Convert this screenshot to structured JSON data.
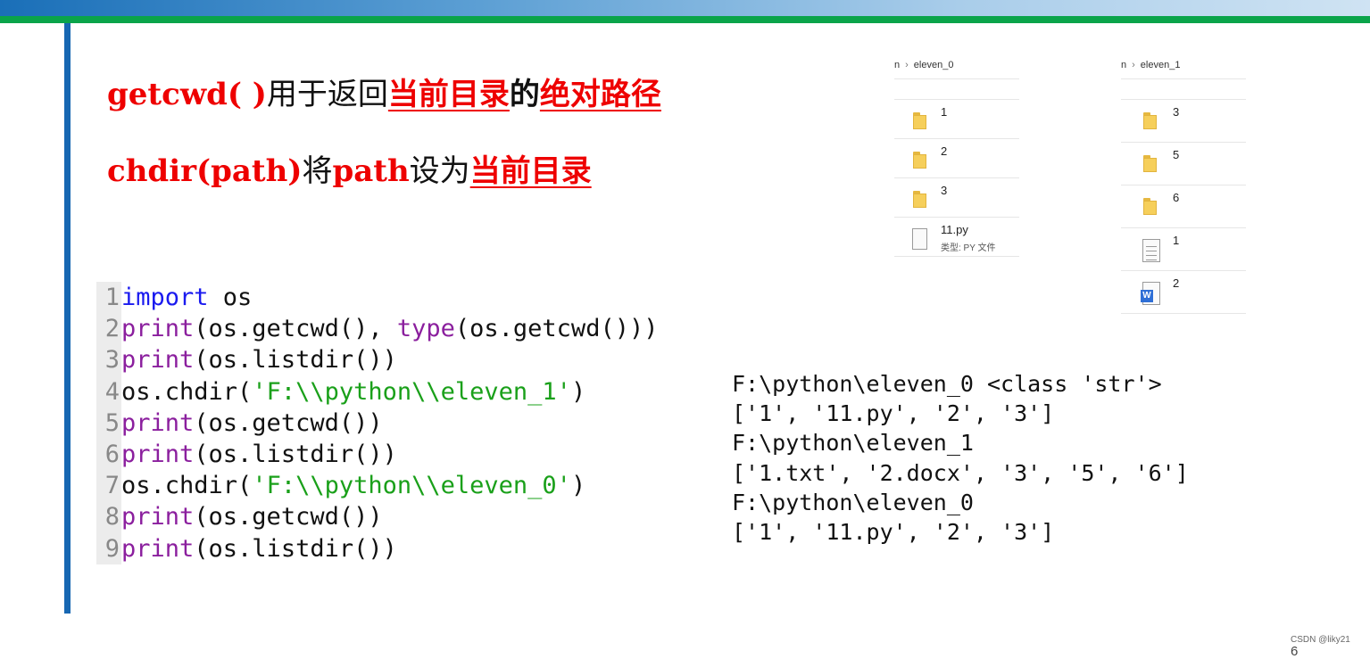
{
  "heading1": {
    "func": "getcwd( )",
    "text1": "用于返回",
    "hl1": "当前目录",
    "text2": "的",
    "hl2": "绝对路径"
  },
  "heading2": {
    "func": "chdir(path)",
    "text1": "将",
    "path": "path",
    "text2": "设为",
    "hl1": "当前目录"
  },
  "code": {
    "lines": [
      {
        "n": "1",
        "parts": [
          [
            "kw",
            "import"
          ],
          [
            "txt",
            " os"
          ]
        ]
      },
      {
        "n": "2",
        "parts": [
          [
            "fn",
            "print"
          ],
          [
            "txt",
            "(os.getcwd(), "
          ],
          [
            "fn",
            "type"
          ],
          [
            "txt",
            "(os.getcwd()))"
          ]
        ]
      },
      {
        "n": "3",
        "parts": [
          [
            "fn",
            "print"
          ],
          [
            "txt",
            "(os.listdir())"
          ]
        ]
      },
      {
        "n": "4",
        "parts": [
          [
            "txt",
            "os.chdir("
          ],
          [
            "str",
            "'F:\\\\python\\\\eleven_1'"
          ],
          [
            "txt",
            ")"
          ]
        ]
      },
      {
        "n": "5",
        "parts": [
          [
            "fn",
            "print"
          ],
          [
            "txt",
            "(os.getcwd())"
          ]
        ]
      },
      {
        "n": "6",
        "parts": [
          [
            "fn",
            "print"
          ],
          [
            "txt",
            "(os.listdir())"
          ]
        ]
      },
      {
        "n": "7",
        "parts": [
          [
            "txt",
            "os.chdir("
          ],
          [
            "str",
            "'F:\\\\python\\\\eleven_0'"
          ],
          [
            "txt",
            ")"
          ]
        ]
      },
      {
        "n": "8",
        "parts": [
          [
            "fn",
            "print"
          ],
          [
            "txt",
            "(os.getcwd())"
          ]
        ]
      },
      {
        "n": "9",
        "parts": [
          [
            "fn",
            "print"
          ],
          [
            "txt",
            "(os.listdir())"
          ]
        ]
      }
    ]
  },
  "output": {
    "lines": [
      "F:\\python\\eleven_0 <class 'str'>",
      "['1', '11.py', '2', '3']",
      "F:\\python\\eleven_1",
      "['1.txt', '2.docx', '3', '5', '6']",
      "F:\\python\\eleven_0",
      "['1', '11.py', '2', '3']"
    ]
  },
  "explorer0": {
    "crumb_prefix": "n",
    "crumb": "eleven_0",
    "items": [
      {
        "name": "1",
        "icon": "folder-icon",
        "sub": ""
      },
      {
        "name": "2",
        "icon": "folder-icon",
        "sub": ""
      },
      {
        "name": "3",
        "icon": "folder-icon",
        "sub": ""
      },
      {
        "name": "11.py",
        "icon": "file-icon",
        "sub": "类型: PY 文件"
      }
    ]
  },
  "explorer1": {
    "crumb_prefix": "n",
    "crumb": "eleven_1",
    "items": [
      {
        "name": "3",
        "icon": "folder-icon",
        "sub": ""
      },
      {
        "name": "5",
        "icon": "folder-icon",
        "sub": ""
      },
      {
        "name": "6",
        "icon": "folder-icon",
        "sub": ""
      },
      {
        "name": "1",
        "icon": "txtfile-icon",
        "sub": ""
      },
      {
        "name": "2",
        "icon": "docx-icon",
        "sub": ""
      }
    ]
  },
  "footer": {
    "watermark": "CSDN @liky21",
    "page": "6"
  },
  "colors": {
    "accent_red": "#ee0000",
    "keyword_blue": "#1a1aef",
    "builtin_purple": "#8b1f9e",
    "string_green": "#1aa01a",
    "banner_green": "#0aa44a",
    "bar_blue": "#1767b2"
  }
}
